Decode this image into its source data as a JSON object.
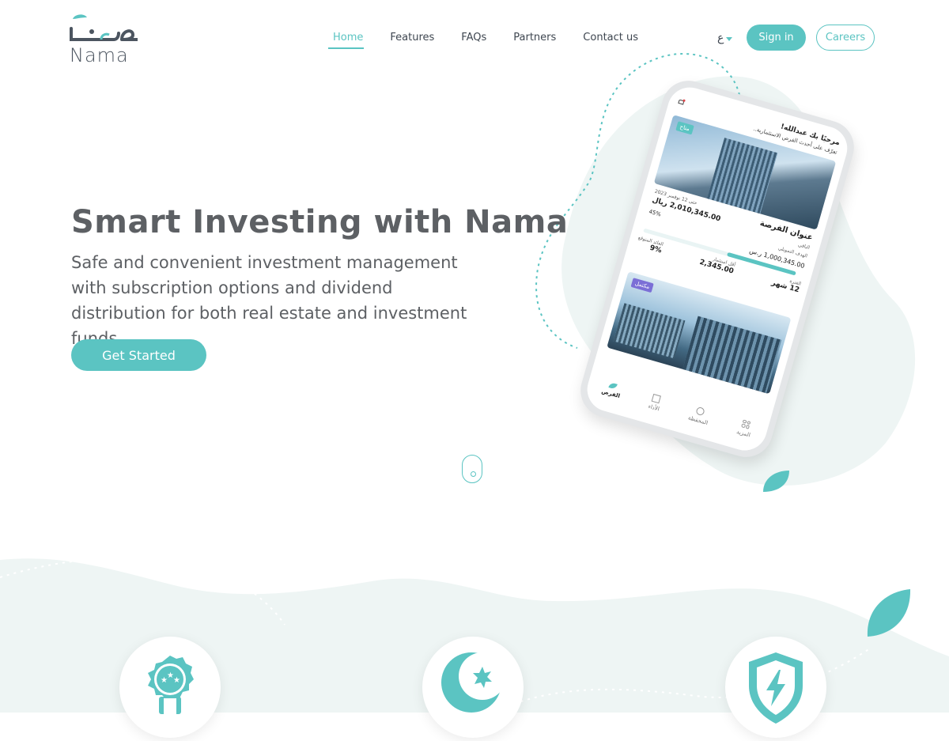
{
  "brand": {
    "logo_ar": "نمـا",
    "logo_en": "Nama",
    "colors": {
      "accent": "#5bc4c2",
      "text": "#5d6064",
      "nav": "#3e4650",
      "blob": "#eef5f4"
    }
  },
  "nav": {
    "items": [
      {
        "label": "Home",
        "active": true
      },
      {
        "label": "Features",
        "active": false
      },
      {
        "label": "FAQs",
        "active": false
      },
      {
        "label": "Partners",
        "active": false
      },
      {
        "label": "Contact us",
        "active": false
      }
    ],
    "language": "ع",
    "signin_label": "Sign in",
    "careers_label": "Careers"
  },
  "hero": {
    "title": "Smart Investing with Nama",
    "subtitle": "Safe and convenient investment management with subscription options and dividend distribution for both real estate and investment funds",
    "cta_label": "Get Started"
  },
  "phone_app": {
    "greeting": "مرحبًا بك عبدالله!",
    "greeting_sub": "تعرّف على أحدث الفرص الاستثمارية..",
    "badge_available": "متاح",
    "badge_completed": "مكتمل",
    "opportunity_title": "عنوان الفرصة",
    "deadline": "حتى 12 نوفمبر 2023",
    "raised": "2,010,345.00 ريال",
    "remaining_label": "الباقي",
    "target_label": "الهدف التمويلي",
    "target_value": "1,000,345.00 ر.س",
    "progress_percent": 45,
    "progress_label": "45%",
    "stats": [
      {
        "label": "العائد المتوقع",
        "value": "9%"
      },
      {
        "label": "أقل استثمار",
        "value": "2,345.00"
      },
      {
        "label": "الفترة",
        "value": "12 شهر"
      }
    ],
    "tabs": [
      "الفرص",
      "الأداء",
      "المحفظة",
      "المزيد"
    ]
  },
  "features": {
    "icons": [
      "award-badge-icon",
      "crescent-star-icon",
      "shield-lightning-icon"
    ]
  }
}
